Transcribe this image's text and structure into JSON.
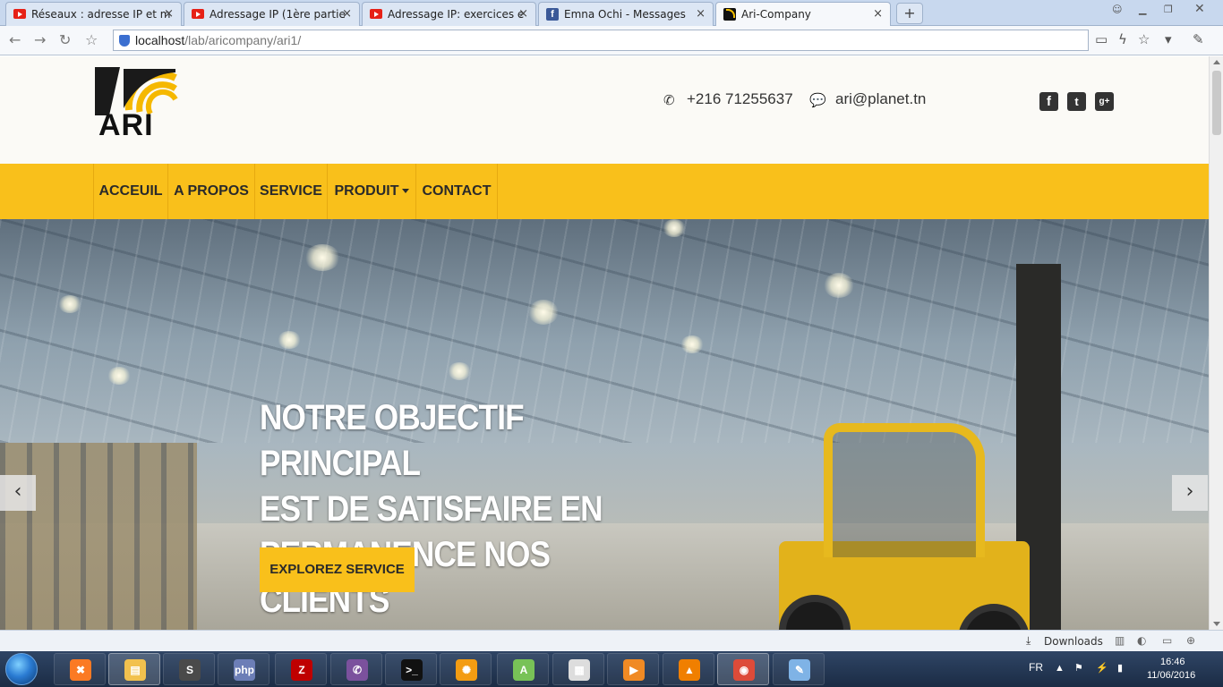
{
  "browser": {
    "tabs": [
      {
        "title": "Réseaux : adresse IP et m",
        "favicon": "youtube-icon",
        "active": false
      },
      {
        "title": "Adressage IP (1ère partie",
        "favicon": "youtube-icon",
        "active": false
      },
      {
        "title": "Adressage IP: exercices e",
        "favicon": "youtube-icon",
        "active": false
      },
      {
        "title": "Emna Ochi - Messages",
        "favicon": "facebook-icon",
        "active": false
      },
      {
        "title": "Ari-Company",
        "favicon": "ari-icon",
        "active": true
      }
    ],
    "new_tab_label": "+",
    "url_host": "localhost",
    "url_path": "/lab/aricompany/ari1/",
    "fb_letter": "f"
  },
  "site": {
    "logo_text": "ARI",
    "phone": "+216 71255637",
    "email": "ari@planet.tn",
    "social": [
      "facebook-icon",
      "twitter-icon",
      "google-plus-icon"
    ],
    "social_glyphs": [
      "f",
      "t",
      "g+"
    ],
    "nav": [
      {
        "label": "ACCEUIL",
        "has_dropdown": false
      },
      {
        "label": "A PROPOS",
        "has_dropdown": false
      },
      {
        "label": "SERVICE",
        "has_dropdown": false
      },
      {
        "label": "PRODUIT",
        "has_dropdown": true
      },
      {
        "label": "CONTACT",
        "has_dropdown": false
      }
    ],
    "hero": {
      "lines": [
        "NOTRE OBJECTIF PRINCIPAL",
        "EST DE SATISFAIRE EN",
        "PERMANENCE NOS CLIENTS"
      ],
      "button_label": "EXPLOREZ SERVICE",
      "prev_glyph": "‹",
      "next_glyph": "›"
    },
    "colors": {
      "accent": "#f9c01b",
      "header_bg": "#fbfaf6",
      "text_dark": "#2a2a2a"
    }
  },
  "statusbar": {
    "downloads_label": "Downloads"
  },
  "taskbar": {
    "lang": "FR",
    "time": "16:46",
    "date": "11/06/2016",
    "apps": [
      {
        "name": "xampp-icon",
        "glyph": "✖",
        "color": "#fb7a24"
      },
      {
        "name": "file-explorer-icon",
        "glyph": "▤",
        "color": "#f2c14e"
      },
      {
        "name": "sublime-text-icon",
        "glyph": "S",
        "color": "#4a4a4a"
      },
      {
        "name": "php-icon",
        "glyph": "php",
        "color": "#6c7eb7"
      },
      {
        "name": "filezilla-icon",
        "glyph": "Z",
        "color": "#bf0000"
      },
      {
        "name": "viber-icon",
        "glyph": "✆",
        "color": "#7b519d"
      },
      {
        "name": "terminal-icon",
        "glyph": ">_",
        "color": "#111111"
      },
      {
        "name": "orange-app-icon",
        "glyph": "✺",
        "color": "#f39c12"
      },
      {
        "name": "android-studio-icon",
        "glyph": "A",
        "color": "#78c257"
      },
      {
        "name": "calculator-icon",
        "glyph": "▦",
        "color": "#dddddd"
      },
      {
        "name": "media-player-icon",
        "glyph": "▶",
        "color": "#f08a24"
      },
      {
        "name": "vlc-icon",
        "glyph": "▲",
        "color": "#f07f00"
      },
      {
        "name": "chrome-icon",
        "glyph": "◉",
        "color": "#dd4b39"
      },
      {
        "name": "paint-icon",
        "glyph": "✎",
        "color": "#7fb3e6"
      }
    ]
  }
}
